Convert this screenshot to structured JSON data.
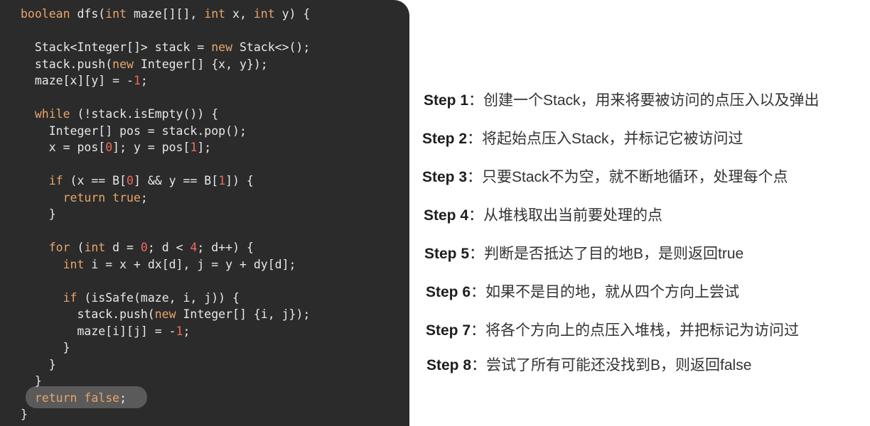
{
  "colors": {
    "code_background": "#2b2b2b",
    "code_text": "#e8e8e8",
    "keyword": "#e8a56a",
    "number": "#ec6a5e",
    "highlight": "#5a5a5a",
    "step_text": "#333333"
  },
  "code": {
    "lines": [
      [
        {
          "t": "boolean",
          "c": "kw"
        },
        {
          "t": " dfs(",
          "c": "plain"
        },
        {
          "t": "int",
          "c": "kw"
        },
        {
          "t": " maze[][], ",
          "c": "plain"
        },
        {
          "t": "int",
          "c": "kw"
        },
        {
          "t": " x, ",
          "c": "plain"
        },
        {
          "t": "int",
          "c": "kw"
        },
        {
          "t": " y) {",
          "c": "plain"
        }
      ],
      [],
      [
        {
          "t": "  Stack<Integer[]> stack = ",
          "c": "plain"
        },
        {
          "t": "new",
          "c": "kw"
        },
        {
          "t": " Stack<>();",
          "c": "plain"
        }
      ],
      [
        {
          "t": "  stack.push(",
          "c": "plain"
        },
        {
          "t": "new",
          "c": "kw"
        },
        {
          "t": " Integer[] {x, y});",
          "c": "plain"
        }
      ],
      [
        {
          "t": "  maze[x][y] = -",
          "c": "plain"
        },
        {
          "t": "1",
          "c": "num"
        },
        {
          "t": ";",
          "c": "plain"
        }
      ],
      [],
      [
        {
          "t": "  ",
          "c": "plain"
        },
        {
          "t": "while",
          "c": "kw"
        },
        {
          "t": " (!stack.isEmpty()) {",
          "c": "plain"
        }
      ],
      [
        {
          "t": "    Integer[] pos = stack.pop();",
          "c": "plain"
        }
      ],
      [
        {
          "t": "    x = pos[",
          "c": "plain"
        },
        {
          "t": "0",
          "c": "num"
        },
        {
          "t": "]; y = pos[",
          "c": "plain"
        },
        {
          "t": "1",
          "c": "num"
        },
        {
          "t": "];",
          "c": "plain"
        }
      ],
      [],
      [
        {
          "t": "    ",
          "c": "plain"
        },
        {
          "t": "if",
          "c": "kw"
        },
        {
          "t": " (x == B[",
          "c": "plain"
        },
        {
          "t": "0",
          "c": "num"
        },
        {
          "t": "] && y == B[",
          "c": "plain"
        },
        {
          "t": "1",
          "c": "num"
        },
        {
          "t": "]) {",
          "c": "plain"
        }
      ],
      [
        {
          "t": "      ",
          "c": "plain"
        },
        {
          "t": "return",
          "c": "kw"
        },
        {
          "t": " ",
          "c": "plain"
        },
        {
          "t": "true",
          "c": "kw"
        },
        {
          "t": ";",
          "c": "plain"
        }
      ],
      [
        {
          "t": "    }",
          "c": "plain"
        }
      ],
      [],
      [
        {
          "t": "    ",
          "c": "plain"
        },
        {
          "t": "for",
          "c": "kw"
        },
        {
          "t": " (",
          "c": "plain"
        },
        {
          "t": "int",
          "c": "kw"
        },
        {
          "t": " d = ",
          "c": "plain"
        },
        {
          "t": "0",
          "c": "num"
        },
        {
          "t": "; d < ",
          "c": "plain"
        },
        {
          "t": "4",
          "c": "num"
        },
        {
          "t": "; d++) {",
          "c": "plain"
        }
      ],
      [
        {
          "t": "      ",
          "c": "plain"
        },
        {
          "t": "int",
          "c": "kw"
        },
        {
          "t": " i = x + dx[d], j = y + dy[d];",
          "c": "plain"
        }
      ],
      [],
      [
        {
          "t": "      ",
          "c": "plain"
        },
        {
          "t": "if",
          "c": "kw"
        },
        {
          "t": " (isSafe(maze, i, j)) {",
          "c": "plain"
        }
      ],
      [
        {
          "t": "        stack.push(",
          "c": "plain"
        },
        {
          "t": "new",
          "c": "kw"
        },
        {
          "t": " Integer[] {i, j});",
          "c": "plain"
        }
      ],
      [
        {
          "t": "        maze[i][j] = -",
          "c": "plain"
        },
        {
          "t": "1",
          "c": "num"
        },
        {
          "t": ";",
          "c": "plain"
        }
      ],
      [
        {
          "t": "      }",
          "c": "plain"
        }
      ],
      [
        {
          "t": "    }",
          "c": "plain"
        }
      ],
      [
        {
          "t": "  }",
          "c": "plain"
        }
      ],
      [
        {
          "t": "  ",
          "c": "plain"
        },
        {
          "t": "return",
          "c": "kw"
        },
        {
          "t": " ",
          "c": "plain"
        },
        {
          "t": "false",
          "c": "kw"
        },
        {
          "t": ";",
          "c": "plain"
        }
      ],
      [
        {
          "t": "}",
          "c": "plain"
        }
      ]
    ]
  },
  "steps": [
    {
      "label": "Step 1",
      "sep": "：",
      "text": "创建一个Stack，用来将要被访问的点压入以及弹出"
    },
    {
      "label": "Step 2",
      "sep": "：",
      "text": "将起始点压入Stack，并标记它被访问过"
    },
    {
      "label": "Step 3",
      "sep": "：",
      "text": "只要Stack不为空，就不断地循环，处理每个点"
    },
    {
      "label": "Step 4",
      "sep": "：",
      "text": "从堆栈取出当前要处理的点"
    },
    {
      "label": "Step 5",
      "sep": "：",
      "text": "判断是否抵达了目的地B，是则返回true"
    },
    {
      "label": "Step 6",
      "sep": "：",
      "text": "如果不是目的地，就从四个方向上尝试"
    },
    {
      "label": "Step 7",
      "sep": "：",
      "text": "将各个方向上的点压入堆栈，并把标记为访问过"
    },
    {
      "label": "Step 8",
      "sep": "：",
      "text": "尝试了所有可能还没找到B，则返回false"
    }
  ]
}
